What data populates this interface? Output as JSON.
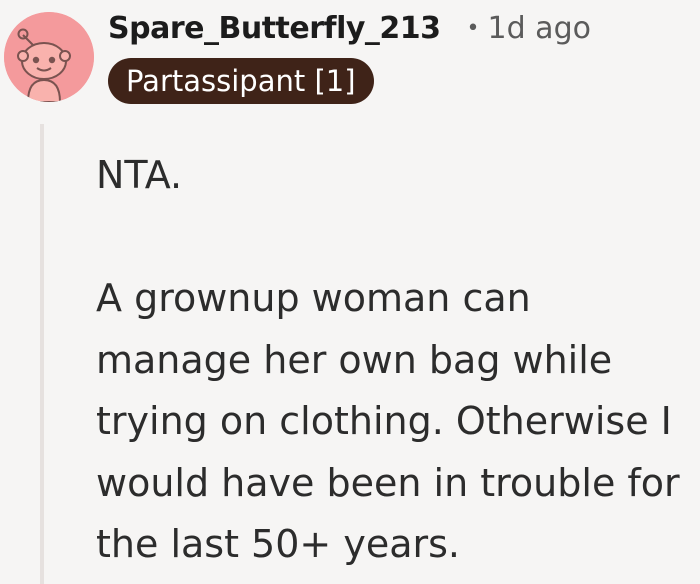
{
  "comment": {
    "author": "Spare_Butterfly_213",
    "separator": "•",
    "time_ago": "1d ago",
    "flair": "Partassipant [1]",
    "avatar_icon": "reddit-snoo-avatar-icon",
    "avatar_color": "#f49a9c",
    "flair_color": "#3f2318",
    "paragraphs": [
      "NTA.",
      "A grownup woman can manage her own bag while trying on clothing. Otherwise I would have been in trouble for the last 50+ years."
    ]
  }
}
